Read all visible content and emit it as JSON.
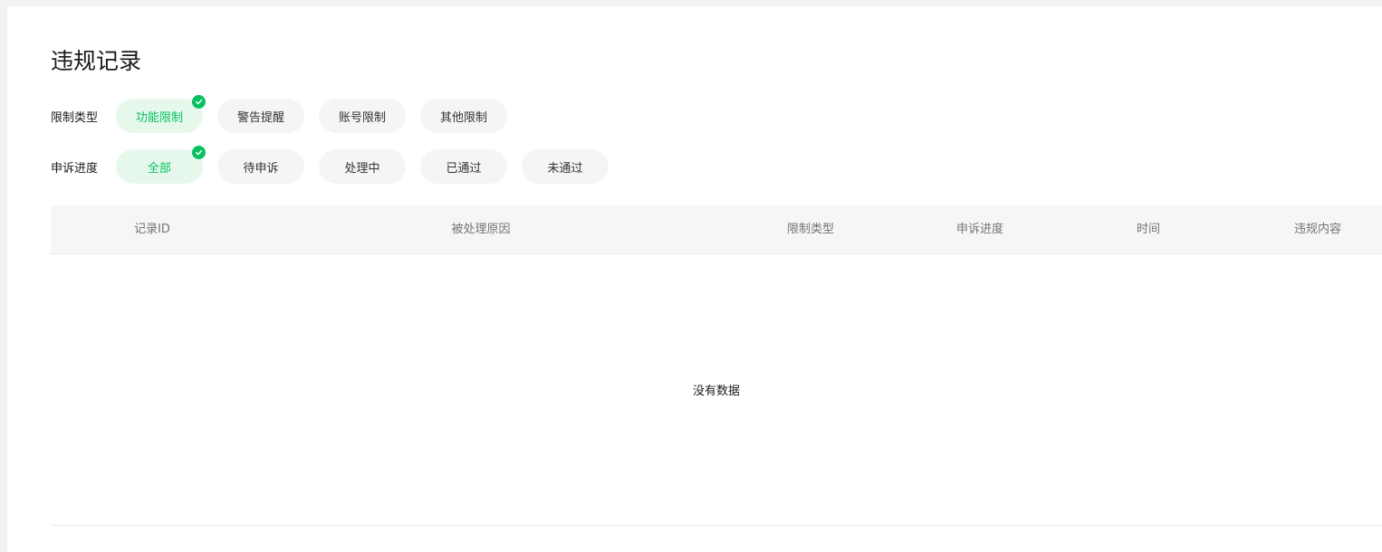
{
  "page": {
    "title": "违规记录"
  },
  "filters": {
    "restriction_type": {
      "label": "限制类型",
      "options": [
        "功能限制",
        "警告提醒",
        "账号限制",
        "其他限制"
      ],
      "selected": "功能限制"
    },
    "appeal_progress": {
      "label": "申诉进度",
      "options": [
        "全部",
        "待申诉",
        "处理中",
        "已通过",
        "未通过"
      ],
      "selected": "全部"
    }
  },
  "table": {
    "columns": [
      "记录ID",
      "被处理原因",
      "限制类型",
      "申诉进度",
      "时间",
      "违规内容"
    ],
    "rows": [],
    "empty_text": "没有数据"
  },
  "colors": {
    "accent": "#07c160",
    "chip_active_bg": "#e6f8ec",
    "chip_bg": "#f5f5f5",
    "header_bg": "#f5f7f7"
  }
}
